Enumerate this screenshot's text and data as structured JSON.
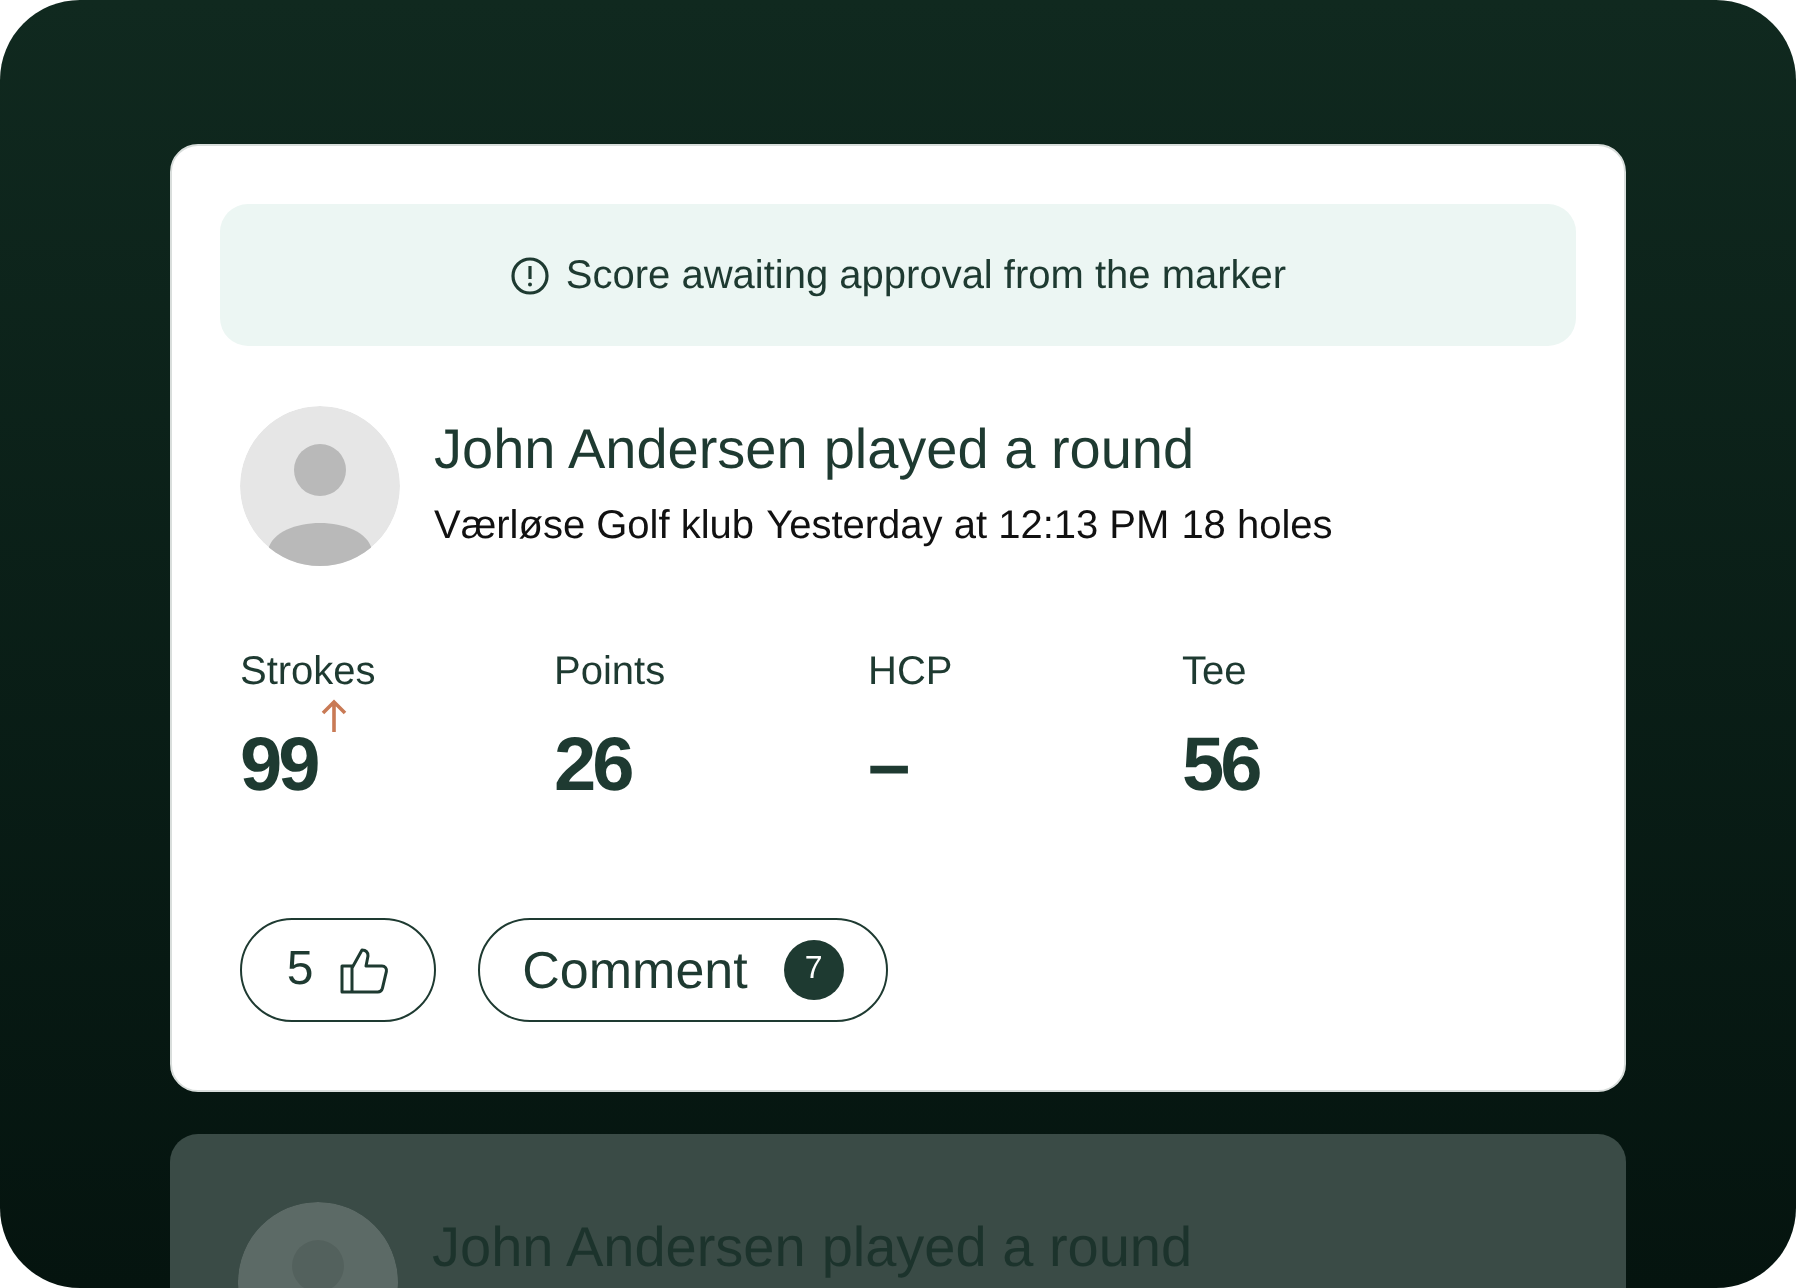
{
  "banner": {
    "text": "Score awaiting approval from the marker"
  },
  "rounds": [
    {
      "player": "John Andersen",
      "action": "played a round",
      "details": [
        "Værløse Golf klub",
        "Yesterday at 12:13 PM",
        "18 holes"
      ],
      "stats": [
        {
          "label": "Strokes",
          "value": "99",
          "trend_up": true
        },
        {
          "label": "Points",
          "value": "26",
          "trend_up": false
        },
        {
          "label": "HCP",
          "value": "–",
          "trend_up": false
        },
        {
          "label": "Tee",
          "value": "56",
          "trend_up": false
        }
      ],
      "likes": "5",
      "comment_label": "Comment",
      "comment_count": "7",
      "dimmed": false
    },
    {
      "player": "John Andersen",
      "action": "played a round",
      "dimmed": true
    }
  ]
}
